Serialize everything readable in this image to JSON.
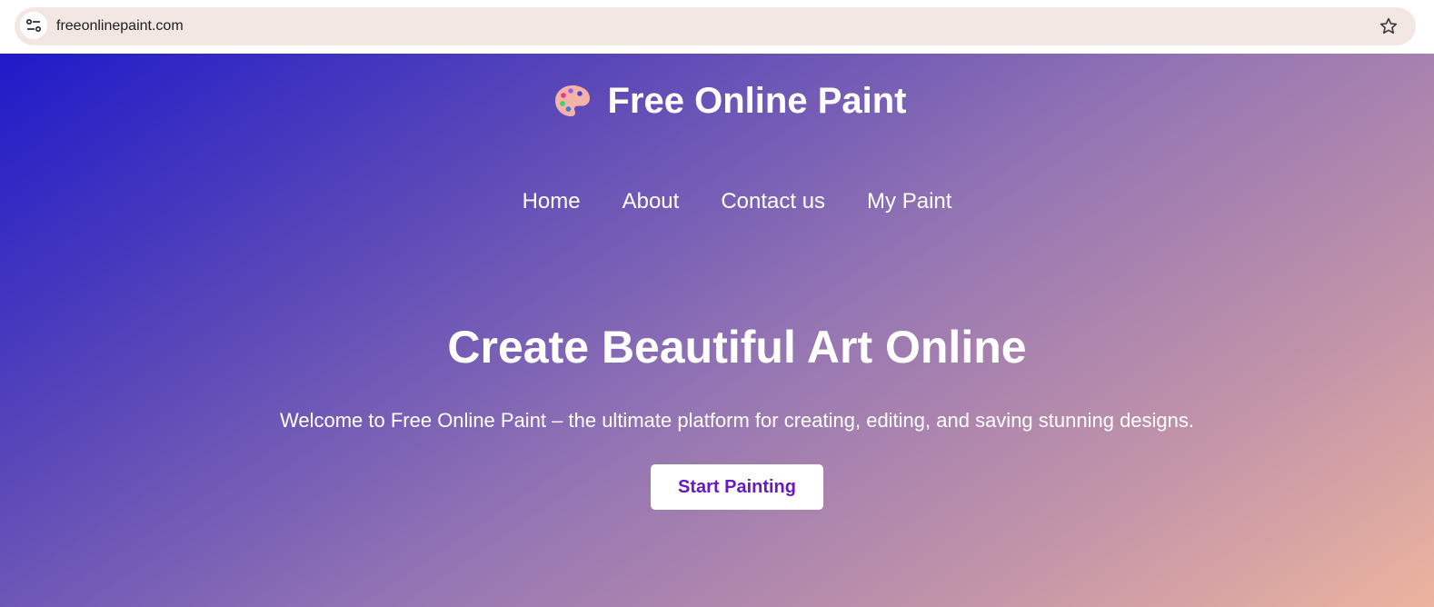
{
  "browser": {
    "url": "freeonlinepaint.com"
  },
  "header": {
    "title": "Free Online Paint",
    "logo_icon": "palette-icon"
  },
  "nav": {
    "items": [
      "Home",
      "About",
      "Contact us",
      "My Paint"
    ]
  },
  "hero": {
    "title": "Create Beautiful Art Online",
    "subtitle": "Welcome to Free Online Paint – the ultimate platform for creating, editing, and saving stunning designs.",
    "cta_label": "Start Painting"
  },
  "colors": {
    "gradient_start": "#1f1ac9",
    "gradient_end": "#ecb49e",
    "cta_text": "#6a17c4",
    "omnibox_bg": "#f3e7e4"
  }
}
